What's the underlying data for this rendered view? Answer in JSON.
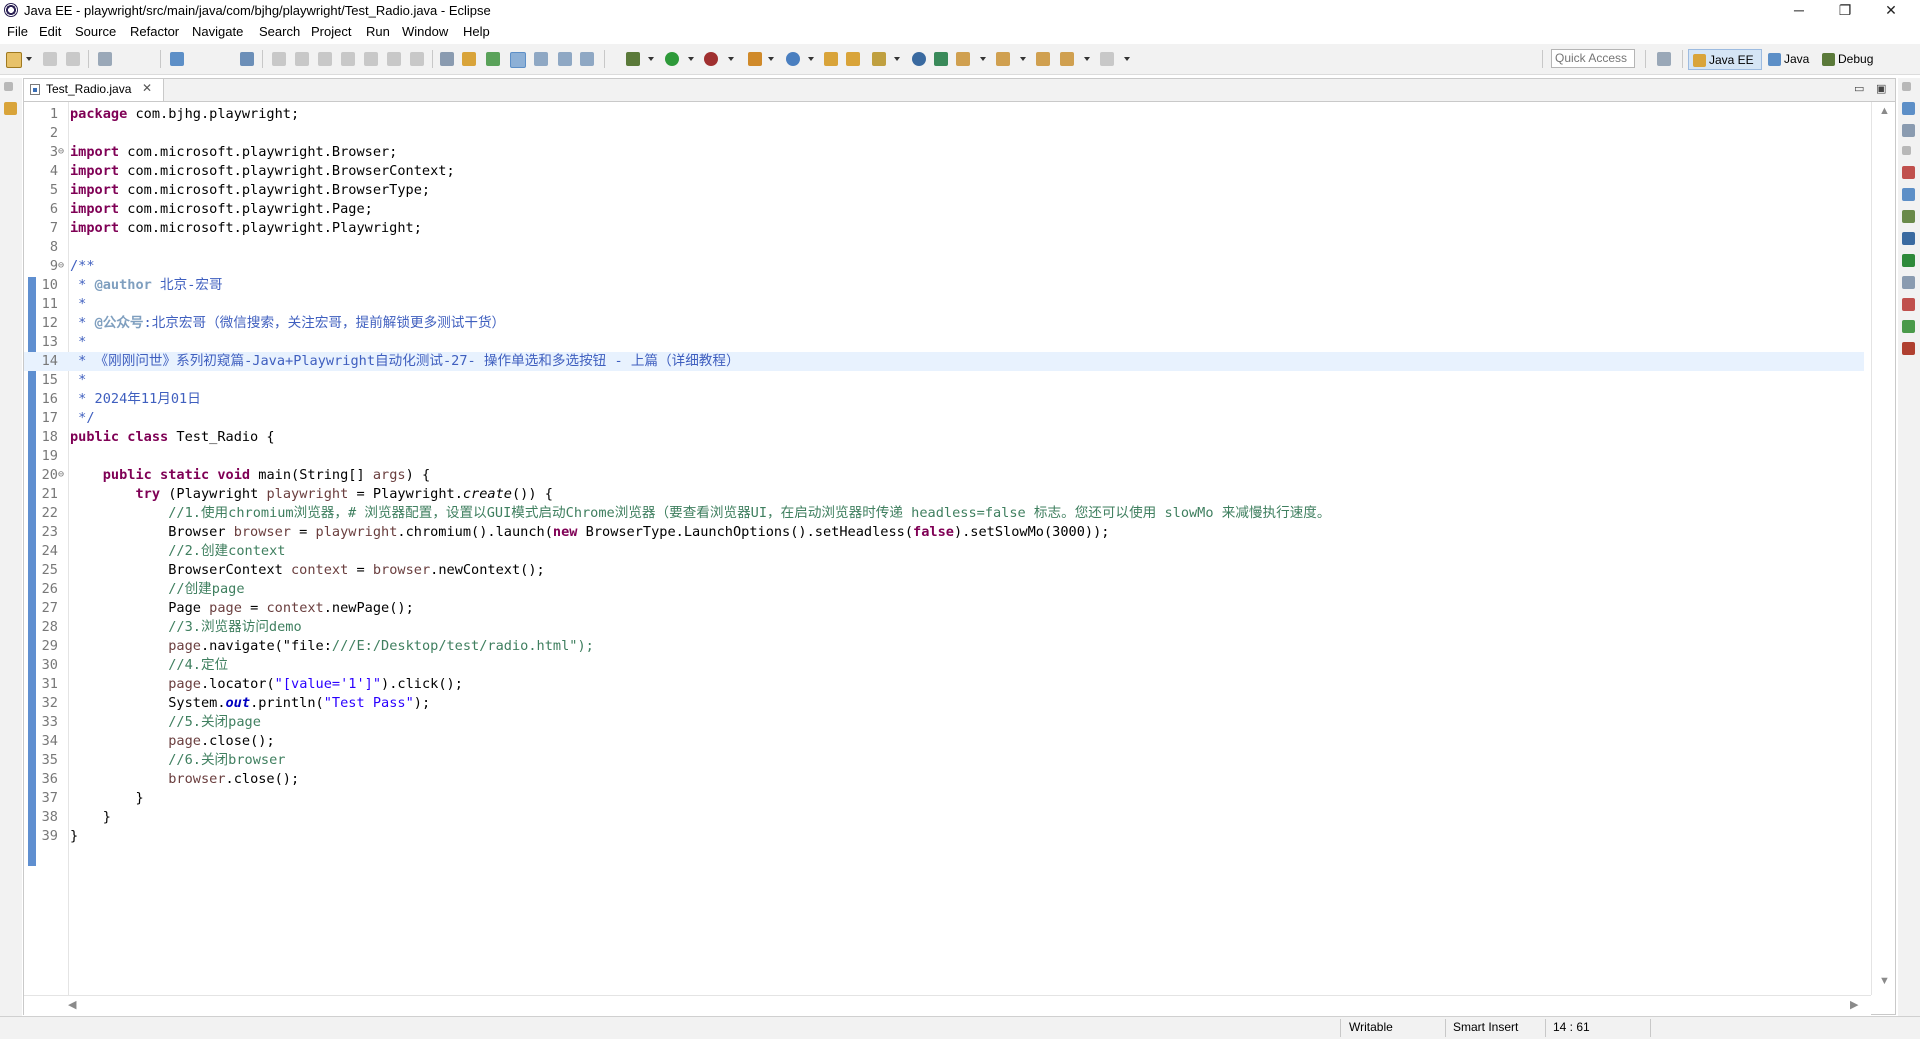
{
  "window": {
    "title": "Java EE - playwright/src/main/java/com/bjhg/playwright/Test_Radio.java - Eclipse",
    "minimize_glyph": "─",
    "restore_glyph": "❐",
    "close_glyph": "✕"
  },
  "menu": [
    "File",
    "Edit",
    "Source",
    "Refactor",
    "Navigate",
    "Search",
    "Project",
    "Run",
    "Window",
    "Help"
  ],
  "toolbar": {
    "quick_access_placeholder": "Quick Access",
    "perspectives": [
      "Java EE",
      "Java",
      "Debug"
    ]
  },
  "editor": {
    "tab_label": "Test_Radio.java",
    "tab_close": "✕",
    "minimize_glyph": "▭",
    "maximize_glyph": "▣",
    "scroll_up": "▲",
    "scroll_down": "▼",
    "scroll_left": "◀",
    "scroll_right": "▶",
    "current_line": 14,
    "lines": [
      {
        "n": "1",
        "fold": "",
        "text": "package com.bjhg.playwright;"
      },
      {
        "n": "2",
        "fold": "",
        "text": ""
      },
      {
        "n": "3",
        "fold": "⊖",
        "text": "import com.microsoft.playwright.Browser;"
      },
      {
        "n": "4",
        "fold": "",
        "text": "import com.microsoft.playwright.BrowserContext;"
      },
      {
        "n": "5",
        "fold": "",
        "text": "import com.microsoft.playwright.BrowserType;"
      },
      {
        "n": "6",
        "fold": "",
        "text": "import com.microsoft.playwright.Page;"
      },
      {
        "n": "7",
        "fold": "",
        "text": "import com.microsoft.playwright.Playwright;"
      },
      {
        "n": "8",
        "fold": "",
        "text": ""
      },
      {
        "n": "9",
        "fold": "⊖",
        "text": "/**"
      },
      {
        "n": "10",
        "fold": "",
        "text": " * @author 北京-宏哥"
      },
      {
        "n": "11",
        "fold": "",
        "text": " *"
      },
      {
        "n": "12",
        "fold": "",
        "text": " * @公众号:北京宏哥（微信搜索，关注宏哥，提前解锁更多测试干货）"
      },
      {
        "n": "13",
        "fold": "",
        "text": " *"
      },
      {
        "n": "14",
        "fold": "",
        "text": " * 《刚刚问世》系列初窥篇-Java+Playwright自动化测试-27- 操作单选和多选按钮 - 上篇（详细教程）"
      },
      {
        "n": "15",
        "fold": "",
        "text": " *"
      },
      {
        "n": "16",
        "fold": "",
        "text": " * 2024年11月01日"
      },
      {
        "n": "17",
        "fold": "",
        "text": " */"
      },
      {
        "n": "18",
        "fold": "",
        "text": "public class Test_Radio {"
      },
      {
        "n": "19",
        "fold": "",
        "text": ""
      },
      {
        "n": "20",
        "fold": "⊖",
        "text": "    public static void main(String[] args) {"
      },
      {
        "n": "21",
        "fold": "",
        "text": "        try (Playwright playwright = Playwright.create()) {"
      },
      {
        "n": "22",
        "fold": "",
        "text": "            //1.使用chromium浏览器，# 浏览器配置，设置以GUI模式启动Chrome浏览器（要查看浏览器UI，在启动浏览器时传递 headless=false 标志。您还可以使用 slowMo 来减慢执行速度。"
      },
      {
        "n": "23",
        "fold": "",
        "text": "            Browser browser = playwright.chromium().launch(new BrowserType.LaunchOptions().setHeadless(false).setSlowMo(3000));"
      },
      {
        "n": "24",
        "fold": "",
        "text": "            //2.创建context"
      },
      {
        "n": "25",
        "fold": "",
        "text": "            BrowserContext context = browser.newContext();"
      },
      {
        "n": "26",
        "fold": "",
        "text": "            //创建page"
      },
      {
        "n": "27",
        "fold": "",
        "text": "            Page page = context.newPage();"
      },
      {
        "n": "28",
        "fold": "",
        "text": "            //3.浏览器访问demo"
      },
      {
        "n": "29",
        "fold": "",
        "text": "            page.navigate(\"file:///E:/Desktop/test/radio.html\");"
      },
      {
        "n": "30",
        "fold": "",
        "text": "            //4.定位"
      },
      {
        "n": "31",
        "fold": "",
        "text": "            page.locator(\"[value='1']\").click();"
      },
      {
        "n": "32",
        "fold": "",
        "text": "            System.out.println(\"Test Pass\");"
      },
      {
        "n": "33",
        "fold": "",
        "text": "            //5.关闭page"
      },
      {
        "n": "34",
        "fold": "",
        "text": "            page.close();"
      },
      {
        "n": "35",
        "fold": "",
        "text": "            //6.关闭browser"
      },
      {
        "n": "36",
        "fold": "",
        "text": "            browser.close();"
      },
      {
        "n": "37",
        "fold": "",
        "text": "        }"
      },
      {
        "n": "38",
        "fold": "",
        "text": "    }"
      },
      {
        "n": "39",
        "fold": "",
        "text": "}"
      }
    ]
  },
  "status": {
    "writable": "Writable",
    "insert_mode": "Smart Insert",
    "cursor_position": "14 : 61"
  },
  "colors": {
    "keyword": "#7f0055",
    "comment": "#3f7f5f",
    "javadoc": "#3f5fbf",
    "string": "#2a00ff",
    "field": "#0000c0",
    "local_var": "#6a3e3e",
    "current_line": "#e8f2fe",
    "change_bar": "#5f8fd0"
  }
}
